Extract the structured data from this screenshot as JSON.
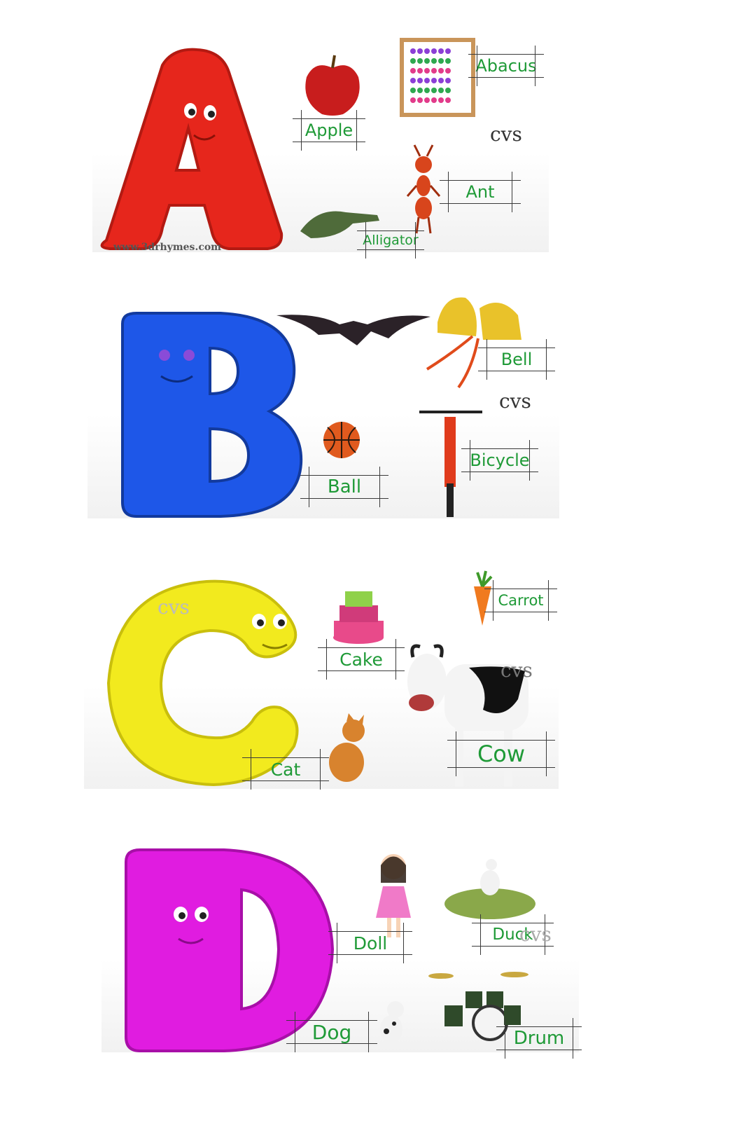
{
  "panels": [
    {
      "letter": "A",
      "color": "#e6261c",
      "labels": [
        "Apple",
        "Abacus",
        "Ant",
        "Alligator"
      ],
      "watermark": "cvs",
      "credit": "www.3drhymes.com"
    },
    {
      "letter": "B",
      "color": "#1e57e8",
      "labels": [
        "Bell",
        "Bicycle",
        "Ball"
      ],
      "watermark": "cvs"
    },
    {
      "letter": "C",
      "color": "#f2ea1e",
      "labels": [
        "Cake",
        "Carrot",
        "Cat",
        "Cow"
      ],
      "watermarks": [
        "cvs",
        "cvs"
      ]
    },
    {
      "letter": "D",
      "color": "#e01ce0",
      "labels": [
        "Doll",
        "Duck",
        "Dog",
        "Drum"
      ],
      "watermark": "cvs"
    }
  ]
}
